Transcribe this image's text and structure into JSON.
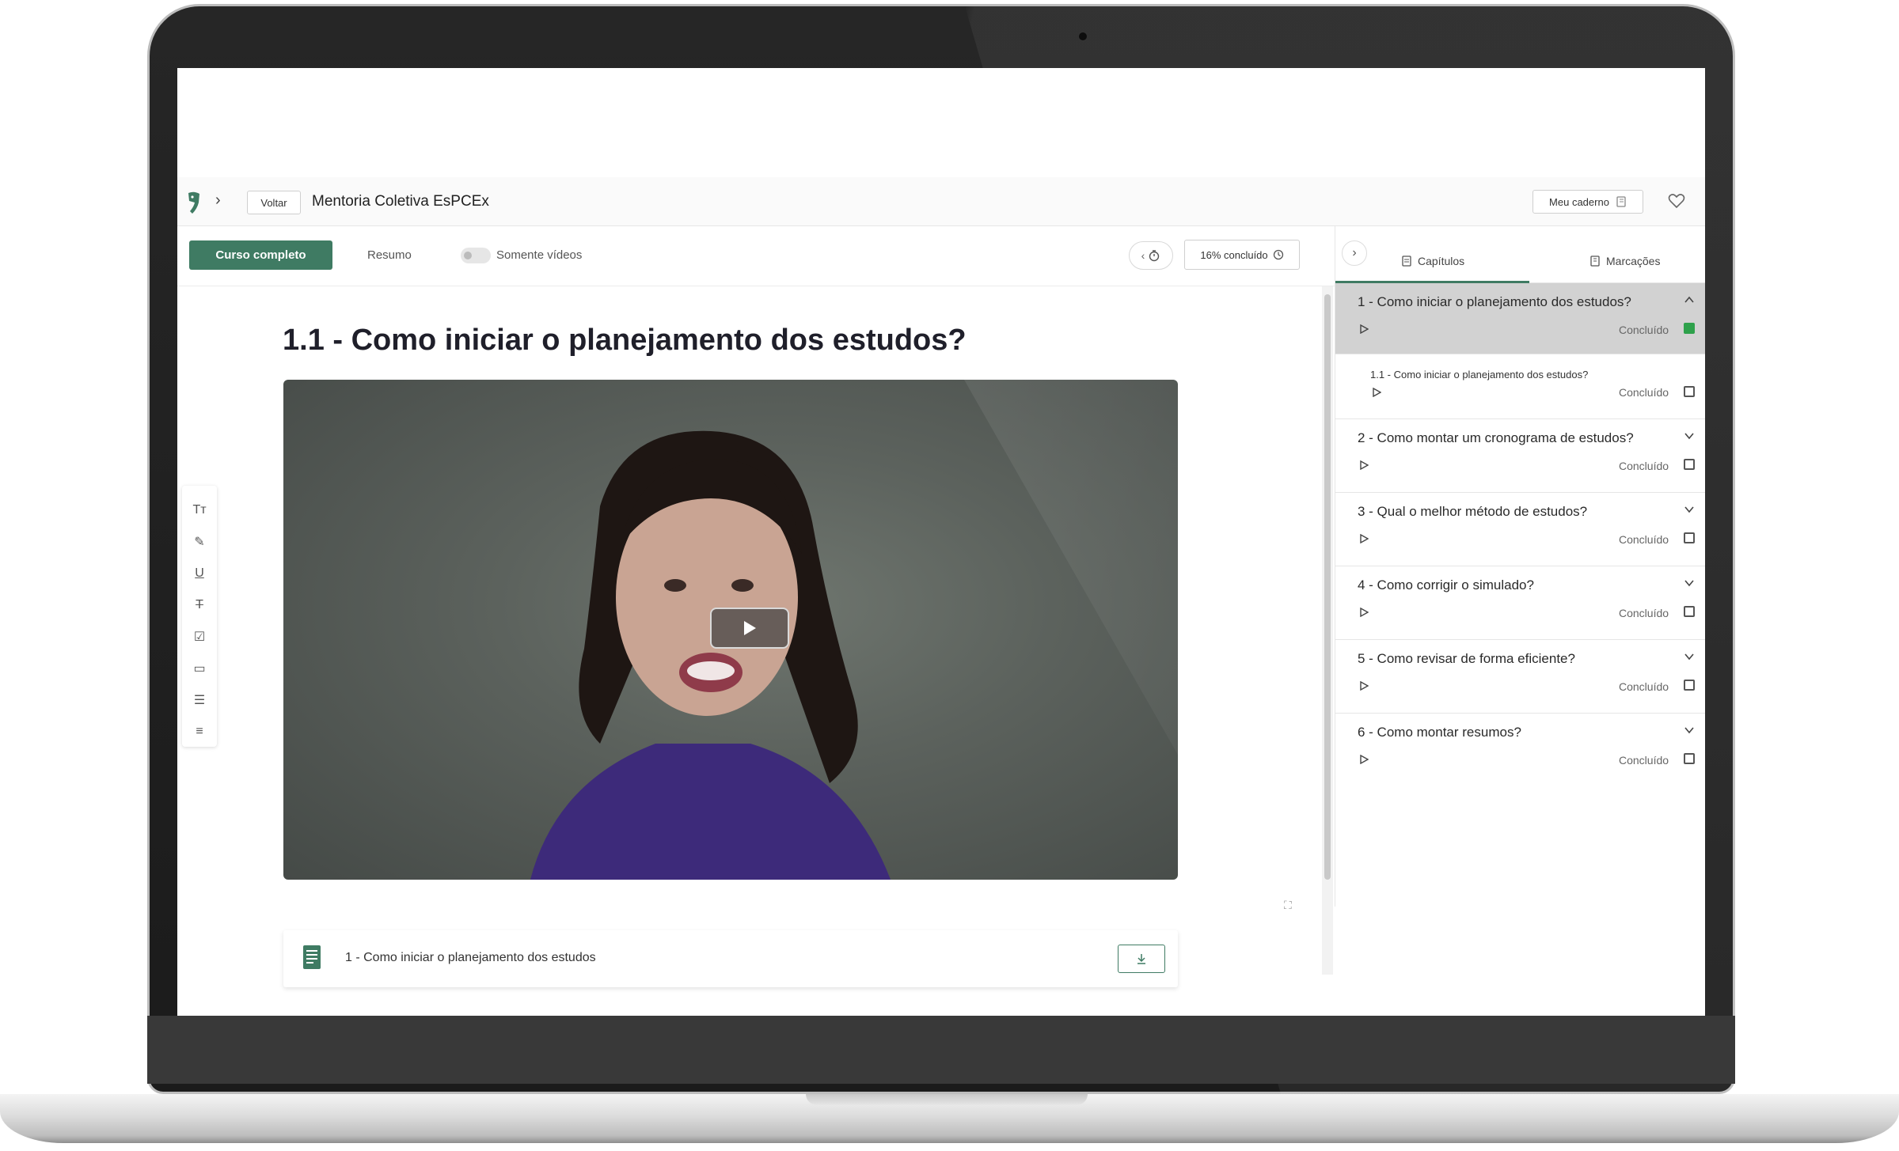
{
  "app": {
    "back_label": "Voltar",
    "course_title": "Mentoria Coletiva EsPCEx",
    "notebook_label": "Meu caderno"
  },
  "toolbar": {
    "full_course_label": "Curso completo",
    "summary_label": "Resumo",
    "videos_only_label": "Somente vídeos",
    "progress_label": "16% concluído",
    "progress_fraction": 0.16
  },
  "lesson": {
    "title": "1.1 - Como iniciar o planejamento dos estudos?",
    "attachment_label": "1 - Como iniciar o planejamento dos estudos"
  },
  "panel": {
    "tabs": [
      "Capítulos",
      "Marcações"
    ],
    "done_label": "Concluído",
    "chapters": [
      {
        "title": "1 - Como iniciar o planejamento dos estudos?",
        "done": true,
        "expanded": true
      },
      {
        "title": "2 - Como montar um cronograma de estudos?",
        "done": false,
        "expanded": false
      },
      {
        "title": "3 - Qual o melhor método de estudos?",
        "done": false,
        "expanded": false
      },
      {
        "title": "4 - Como corrigir o simulado?",
        "done": false,
        "expanded": false
      },
      {
        "title": "5 - Como revisar de forma eficiente?",
        "done": false,
        "expanded": false
      },
      {
        "title": "6 - Como montar resumos?",
        "done": false,
        "expanded": false
      }
    ],
    "subchapter": {
      "title": "1.1 - Como iniciar o planejamento dos estudos?",
      "done": false
    }
  },
  "colors": {
    "accent": "#3f7b63",
    "checked": "#2ea14b",
    "active_chapter_bg": "#d2d2d2"
  },
  "icons": {
    "tools": [
      "text-size-icon",
      "highlighter-icon",
      "underline-icon",
      "strikethrough-icon",
      "note-icon",
      "comment-icon",
      "indent-icon",
      "list-icon"
    ]
  }
}
